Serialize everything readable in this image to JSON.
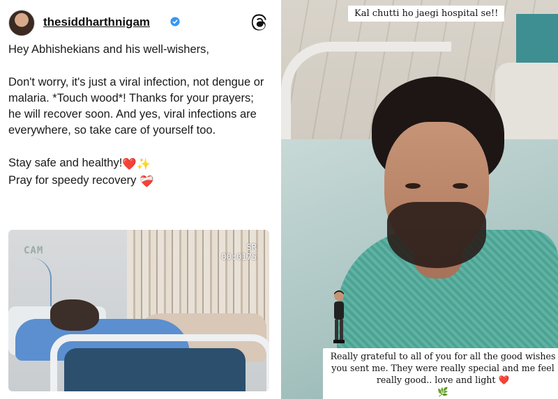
{
  "left_post": {
    "username": "thesiddharthnigam",
    "paragraphs": [
      "Hey Abhishekians and his well-wishers,",
      "Don't worry, it's just a viral infection, not dengue or malaria. *Touch wood*! Thanks for your prayers; he will recover soon. And yes, viral infections are everywhere, so take care of yourself too.",
      "Stay safe and healthy!",
      "Pray for speedy recovery"
    ],
    "emoji_after_stay_safe": "❤️✨",
    "emoji_after_pray": "❤️‍🩹",
    "photo": {
      "cam_label": "CAM",
      "sr_label": "SR",
      "counter": "00:0175"
    },
    "icons": [
      "avatar",
      "verified-badge-icon",
      "threads-logo-icon"
    ]
  },
  "right_story": {
    "top_sticker": "Kal chutti ho jaegi hospital se!!",
    "bottom_caption": "Really grateful to all of you for all the good wishes you sent me. They were really special and me feel really good.. love and light",
    "bottom_heart": "❤️",
    "bottom_leaf": "🌿",
    "icons": [
      "bitmoji-figure-icon"
    ]
  },
  "colors": {
    "verified_blue": "#3797f0",
    "gown_teal": "#5eb3a3",
    "heart_red": "#e02020"
  }
}
